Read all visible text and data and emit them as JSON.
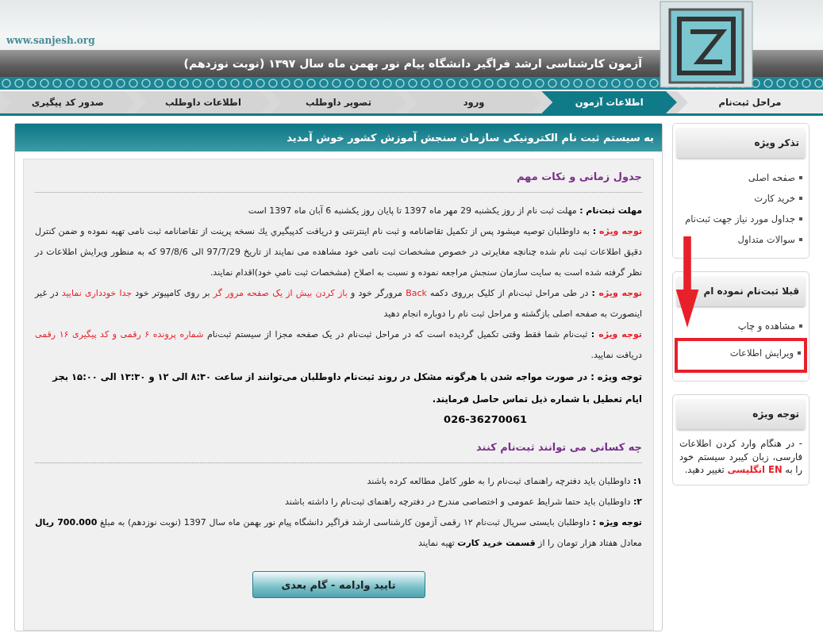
{
  "header": {
    "site_url": "www.sanjesh.org",
    "title": "آزمون کارشناسی ارشد فراگیر دانشگاه پیام نور بهمن ماه سال ۱۳۹۷ (نوبت نوزدهم)"
  },
  "steps": [
    {
      "label": "مراحل ثبت‌نام",
      "kind": "caption"
    },
    {
      "label": "اطلاعات آزمون",
      "kind": "step",
      "selected": true
    },
    {
      "label": "ورود",
      "kind": "step",
      "selected": false
    },
    {
      "label": "تصویر داوطلب",
      "kind": "step",
      "selected": false
    },
    {
      "label": "اطلاعات داوطلب",
      "kind": "step",
      "selected": false
    },
    {
      "label": "صدور کد پیگیری",
      "kind": "step",
      "selected": false
    }
  ],
  "sidebar": [
    {
      "title": "تذکر ویژه",
      "kind": "links",
      "items": [
        {
          "label": "صفحه اصلی",
          "highlighted": false
        },
        {
          "label": "خرید کارت",
          "highlighted": false
        },
        {
          "label": "جداول مورد نیاز جهت ثبت‌نام",
          "highlighted": false
        },
        {
          "label": "سوالات متداول",
          "highlighted": false
        }
      ]
    },
    {
      "title": "قبلا ثبت‌نام نموده ام",
      "kind": "links",
      "items": [
        {
          "label": "مشاهده و چاپ",
          "highlighted": false
        },
        {
          "label": "ویرایش اطلاعات",
          "highlighted": true
        }
      ]
    },
    {
      "title": "توجه ویژه",
      "kind": "note",
      "segments": [
        {
          "text": "- در هنگام وارد کردن اطلاعات فارسی، زبان کیبرد سیستم خود را به ",
          "kind": "plain"
        },
        {
          "text": "EN انگلیسی",
          "kind": "alert"
        },
        {
          "text": " تغییر دهید.",
          "kind": "plain"
        }
      ]
    }
  ],
  "main": {
    "title": "به سیستم ثبت نام الکترونیکی سازمان سنجش آموزش کشور خوش آمدید",
    "blocks": [
      {
        "kind": "heading",
        "text": "جدول زمانی و نکات مهم"
      },
      {
        "kind": "para",
        "segments": [
          {
            "text": "مهلت ثبت‌نام :",
            "kind": "label"
          },
          {
            "text": " مهلت ثبت نام از روز یکشنبه 29 مهر ماه 1397 تا پایان روز یکشنبه 6 آبان ماه 1397 است",
            "kind": "plain"
          }
        ]
      },
      {
        "kind": "para",
        "segments": [
          {
            "text": "توجه ویژه",
            "kind": "alert"
          },
          {
            "text": " :",
            "kind": "label"
          },
          {
            "text": " به داوطلبان توصیه میشود پس از تکمیل تقاضانامه و ثبت نام اینترنتی و دریافت کدپیگیري يك نسخه پرينت از تقاضانامه ثبت نامی تهیه نموده و ضمن کنترل دقیق اطلاعات ثبت نام شده چنانچه مغایرتی در خصوص مشخصات ثبت نامی خود مشاهده می نمایند از تاریخ 97/7/29 الی 97/8/6 که به منظور ویرایش اطلاعات در نظر گرفته شده است به سایت سازمان سنجش مراجعه نموده و نسبت به اصلاح (مشخصات ثبت نامي خود)اقدام نمایند.",
            "kind": "plain"
          }
        ]
      },
      {
        "kind": "para",
        "segments": [
          {
            "text": "توجه ویژه",
            "kind": "alert"
          },
          {
            "text": " :",
            "kind": "label"
          },
          {
            "text": " در طی مراحل ثبت‌نام از کلیک برروی دکمه ",
            "kind": "plain"
          },
          {
            "text": "Back",
            "kind": "red"
          },
          {
            "text": " مرورگر خود و ",
            "kind": "plain"
          },
          {
            "text": "باز کردن بیش از یک صفحه مرور گر",
            "kind": "red"
          },
          {
            "text": " بر روی کامپیوتر خود ",
            "kind": "plain"
          },
          {
            "text": "جدا خودداری نمایید",
            "kind": "red"
          },
          {
            "text": " در غیر اینصورت به صفحه اصلی بازگشته و مراحل ثبت نام را دوباره انجام دهید",
            "kind": "plain"
          }
        ]
      },
      {
        "kind": "para",
        "segments": [
          {
            "text": "توجه ویژه",
            "kind": "alert"
          },
          {
            "text": " :",
            "kind": "label"
          },
          {
            "text": " ثبت‌نام شما فقط وقتی تکمیل گردیده است که در مراحل ثبت‌نام در یک صفحه مجزا از سیستم ثبت‌نام ",
            "kind": "plain"
          },
          {
            "text": "شماره پرونده ۶ رقمی و کد پیگیری ۱۶ رقمی",
            "kind": "red"
          },
          {
            "text": " دریافت نمایید.",
            "kind": "plain"
          }
        ]
      },
      {
        "kind": "bold-para",
        "text": "توجه ویژه : در صورت مواجه شدن با هرگونه مشکل در روند ثبت‌نام داوطلبان می‌توانند از ساعت ۸:۳۰ الی ۱۲ و ۱۳:۳۰ الی ۱۵:۰۰ بجز ایام تعطیل با شماره ذیل تماس حاصل فرمایند."
      },
      {
        "kind": "phone",
        "text": "026-36270061"
      },
      {
        "kind": "heading",
        "text": "چه کسانی می توانند ثبت‌نام کنند"
      },
      {
        "kind": "para",
        "segments": [
          {
            "text": "۱:",
            "kind": "label"
          },
          {
            "text": " داوطلبان باید دفترچه راهنمای ثبت‌نام را به طور کامل مطالعه کرده باشند",
            "kind": "plain"
          }
        ]
      },
      {
        "kind": "para",
        "segments": [
          {
            "text": "۲:",
            "kind": "label"
          },
          {
            "text": " داوطلبان باید حتما شرایط عمومی و اختصاصی مندرج در دفترچه راهنمای ثبت‌نام را داشته باشند",
            "kind": "plain"
          }
        ]
      },
      {
        "kind": "para",
        "segments": [
          {
            "text": "توجه ویژه :",
            "kind": "label"
          },
          {
            "text": " داوطلبان بایستی سریال ثبت‌نام ۱۲ رقمی آزمون کارشناسی ارشد فراگیر دانشگاه پیام نور بهمن ماه سال 1397 (نوبت نوزدهم) به مبلغ ",
            "kind": "plain"
          },
          {
            "text": "700.000 ریال",
            "kind": "label"
          },
          {
            "text": " معادل هفتاد هزار تومان را از ",
            "kind": "plain"
          },
          {
            "text": "قسمت خرید کارت",
            "kind": "label"
          },
          {
            "text": " تهیه نمایند",
            "kind": "plain"
          }
        ]
      }
    ],
    "button": "تایید وادامه - گام بعدی"
  }
}
